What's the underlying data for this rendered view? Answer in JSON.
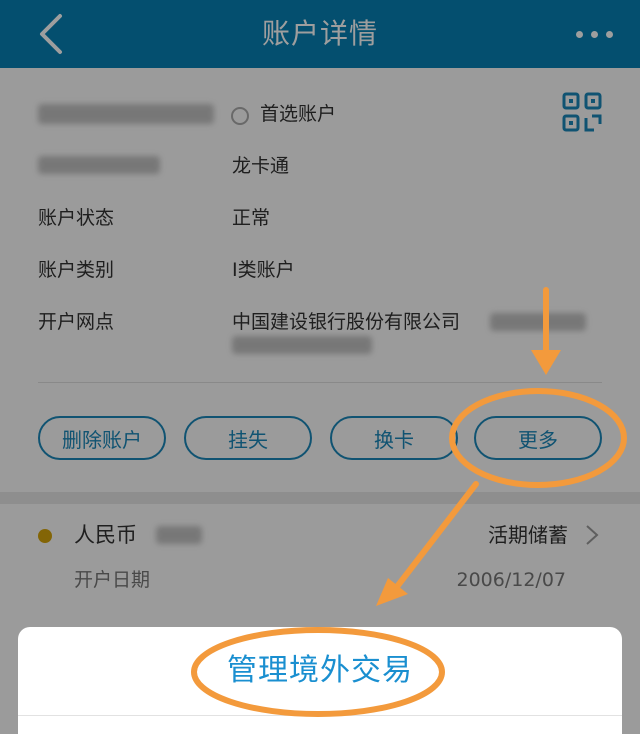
{
  "header": {
    "title": "账户详情"
  },
  "account": {
    "preferred_label": "首选账户",
    "card_name": "龙卡通",
    "rows": [
      {
        "label": "账户状态",
        "value": "正常"
      },
      {
        "label": "账户类别",
        "value": "I类账户"
      },
      {
        "label": "开户网点",
        "value": "中国建设银行股份有限公司"
      }
    ]
  },
  "actions": [
    {
      "label": "删除账户"
    },
    {
      "label": "挂失"
    },
    {
      "label": "换卡"
    },
    {
      "label": "更多"
    }
  ],
  "sub_account": {
    "currency": "人民币",
    "type": "活期储蓄",
    "open_date_label": "开户日期",
    "open_date": "2006/12/07"
  },
  "sheet": {
    "item": "管理境外交易"
  },
  "colors": {
    "header": "#0880b4",
    "accent": "#1a87b8",
    "annotation": "#f39a3c",
    "dot": "#d4a30a"
  }
}
